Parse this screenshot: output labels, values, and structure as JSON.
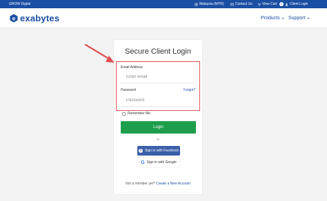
{
  "topbar": {
    "brand": "GROW Digital",
    "region": "Malaysia (MYR)",
    "contact": "Contact Us",
    "view_cart": "View Cart",
    "cart_count": "0",
    "client_login": "Client Login"
  },
  "navbar": {
    "logo": "exabytes",
    "products": "Products",
    "support": "Support"
  },
  "login": {
    "title": "Secure Client Login",
    "email_label": "Email Address",
    "email_placeholder": "Enter email",
    "password_label": "Password",
    "forgot": "Forgot?",
    "password_placeholder": "Password",
    "remember": "Remember Me",
    "login_button": "Login",
    "or": "or",
    "facebook": "Sign in with Facebook",
    "google": "Sign in with Google",
    "not_member": "Not a member yet?",
    "create_account": "Create a New Account"
  },
  "colors": {
    "brand_blue": "#1a4fa3",
    "login_green": "#1e9e4a",
    "highlight_red": "#e05050",
    "facebook_blue": "#3b5fa8"
  }
}
